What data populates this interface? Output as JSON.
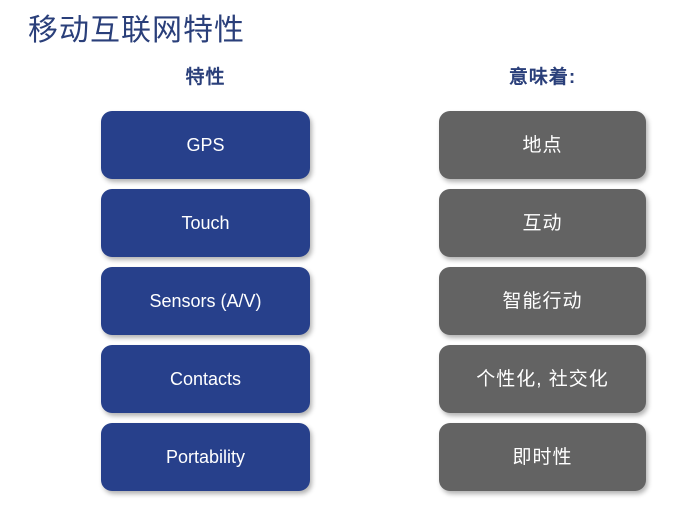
{
  "slide": {
    "title": "移动互联网特性",
    "title_color": "#2a3f7a",
    "background_color": "#ffffff"
  },
  "columns": {
    "left": {
      "header": "特性",
      "box_color": "#27408b",
      "text_color": "#ffffff",
      "items": [
        {
          "label": "GPS"
        },
        {
          "label": "Touch"
        },
        {
          "label": "Sensors (A/V)"
        },
        {
          "label": "Contacts"
        },
        {
          "label": "Portability"
        }
      ]
    },
    "right": {
      "header": "意味着:",
      "box_color": "#636363",
      "text_color": "#ffffff",
      "items": [
        {
          "label": "地点"
        },
        {
          "label": "互动"
        },
        {
          "label": "智能行动"
        },
        {
          "label": "个性化, 社交化"
        },
        {
          "label": "即时性"
        }
      ]
    }
  }
}
